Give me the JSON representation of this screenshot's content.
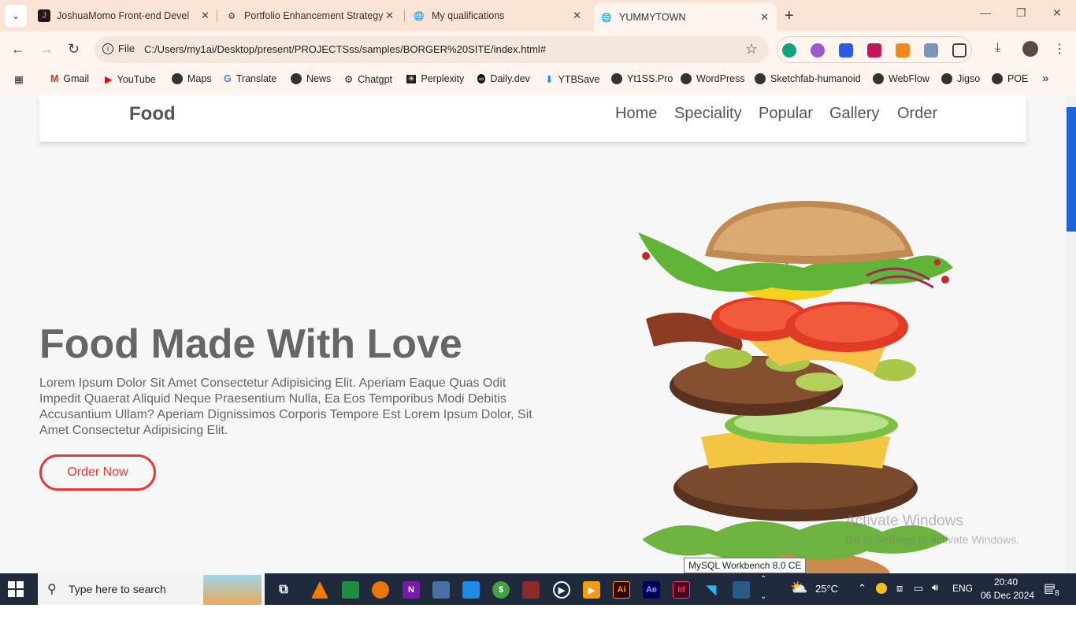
{
  "browser": {
    "tabs": [
      {
        "title": "JoshuaMomo Front-end Develo",
        "icon": "j-icon"
      },
      {
        "title": "Portfolio Enhancement Strategy",
        "icon": "chatgpt-icon"
      },
      {
        "title": "My qualifications",
        "icon": "globe-icon"
      },
      {
        "title": "YUMMYTOWN",
        "icon": "globe-icon",
        "active": true
      }
    ],
    "address": {
      "scheme_label": "File",
      "url": "C:/Users/my1ai/Desktop/present/PROJECTSss/samples/BORGER%20SITE/index.html#"
    },
    "bookmarks": [
      "Gmail",
      "YouTube",
      "Maps",
      "Translate",
      "News",
      "Chatgpt",
      "Perplexity",
      "Daily.dev",
      "YTBSave",
      "Yt1SS.Pro",
      "WordPress",
      "Sketchfab-humanoid",
      "WebFlow",
      "Jigso",
      "POE"
    ]
  },
  "site": {
    "logo": "Food",
    "nav": [
      "Home",
      "Speciality",
      "Popular",
      "Gallery",
      "Order"
    ],
    "hero": {
      "title": "Food Made With Love",
      "text": "Lorem Ipsum Dolor Sit Amet Consectetur Adipisicing Elit. Aperiam Eaque Quas Odit Impedit Quaerat Aliquid Neque Praesentium Nulla, Ea Eos Temporibus Modi Debitis Accusantium Ullam? Aperiam Dignissimos Corporis Tempore Est Lorem Ipsum Dolor, Sit Amet Consectetur Adipisicing Elit.",
      "button": "Order Now"
    },
    "accent_color": "#e53935"
  },
  "watermark": {
    "line1": "Activate Windows",
    "line2": "Go to Settings to activate Windows."
  },
  "tooltip": "MySQL Workbench 8.0 CE",
  "taskbar": {
    "search_placeholder": "Type here to search",
    "weather": "25°C",
    "language": "ENG",
    "time": "20:40",
    "date": "06 Dec 2024",
    "notifications": "8"
  }
}
